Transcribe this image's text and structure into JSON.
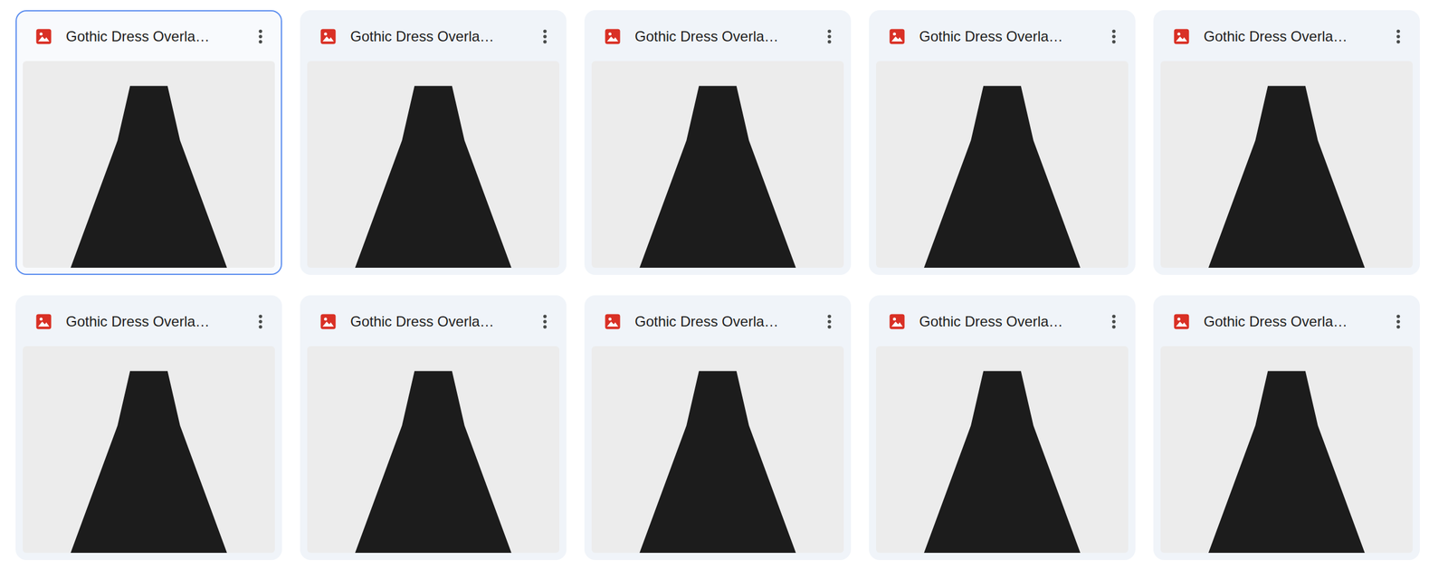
{
  "files": [
    {
      "name": "Gothic Dress Overla…",
      "selected": true
    },
    {
      "name": "Gothic Dress Overla…",
      "selected": false
    },
    {
      "name": "Gothic Dress Overla…",
      "selected": false
    },
    {
      "name": "Gothic Dress Overla…",
      "selected": false
    },
    {
      "name": "Gothic Dress Overla…",
      "selected": false
    },
    {
      "name": "Gothic Dress Overla…",
      "selected": false
    },
    {
      "name": "Gothic Dress Overla…",
      "selected": false
    },
    {
      "name": "Gothic Dress Overla…",
      "selected": false
    },
    {
      "name": "Gothic Dress Overla…",
      "selected": false
    },
    {
      "name": "Gothic Dress Overla…",
      "selected": false
    }
  ]
}
